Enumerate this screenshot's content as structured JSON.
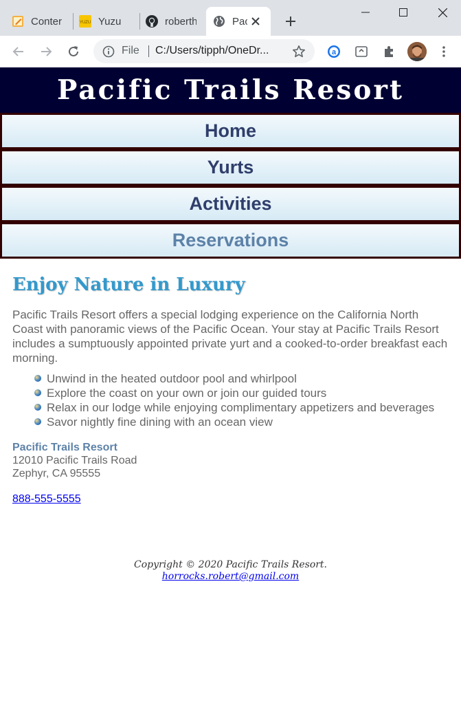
{
  "browser": {
    "tabs": [
      {
        "title": "Conter",
        "icon": "pencil-note-icon"
      },
      {
        "title": "Yuzu",
        "icon": "yuzu-icon"
      },
      {
        "title": "roberth",
        "icon": "github-icon"
      },
      {
        "title": "Pac",
        "icon": "globe-icon",
        "active": true
      }
    ],
    "address": {
      "scheme_label": "File",
      "url": "C:/Users/tipph/OneDr..."
    }
  },
  "site": {
    "title": "Pacific Trails Resort",
    "nav": [
      "Home",
      "Yurts",
      "Activities",
      "Reservations"
    ]
  },
  "main": {
    "heading": "Enjoy Nature in Luxury",
    "intro": "Pacific Trails Resort offers a special lodging experience on the California North Coast with panoramic views of the Pacific Ocean. Your stay at Pacific Trails Resort includes a sumptuously appointed private yurt and a cooked-to-order breakfast each morning.",
    "features": [
      "Unwind in the heated outdoor pool and whirlpool",
      "Explore the coast on your own or join our guided tours",
      "Relax in our lodge while enjoying complimentary appetizers and beverages",
      "Savor nightly fine dining with an ocean view"
    ],
    "contact": {
      "name": "Pacific Trails Resort",
      "street": "12010 Pacific Trails Road",
      "city": "Zephyr, CA 95555",
      "phone": "888-555-5555"
    }
  },
  "footer": {
    "copyright": "Copyright © 2020 Pacific Trails Resort.",
    "email": "horrocks.robert@gmail.com"
  },
  "colors": {
    "header_bg": "#000033",
    "heading": "#3399cc",
    "nav_text": "#2f3e6b",
    "nav_border": "#330000"
  }
}
